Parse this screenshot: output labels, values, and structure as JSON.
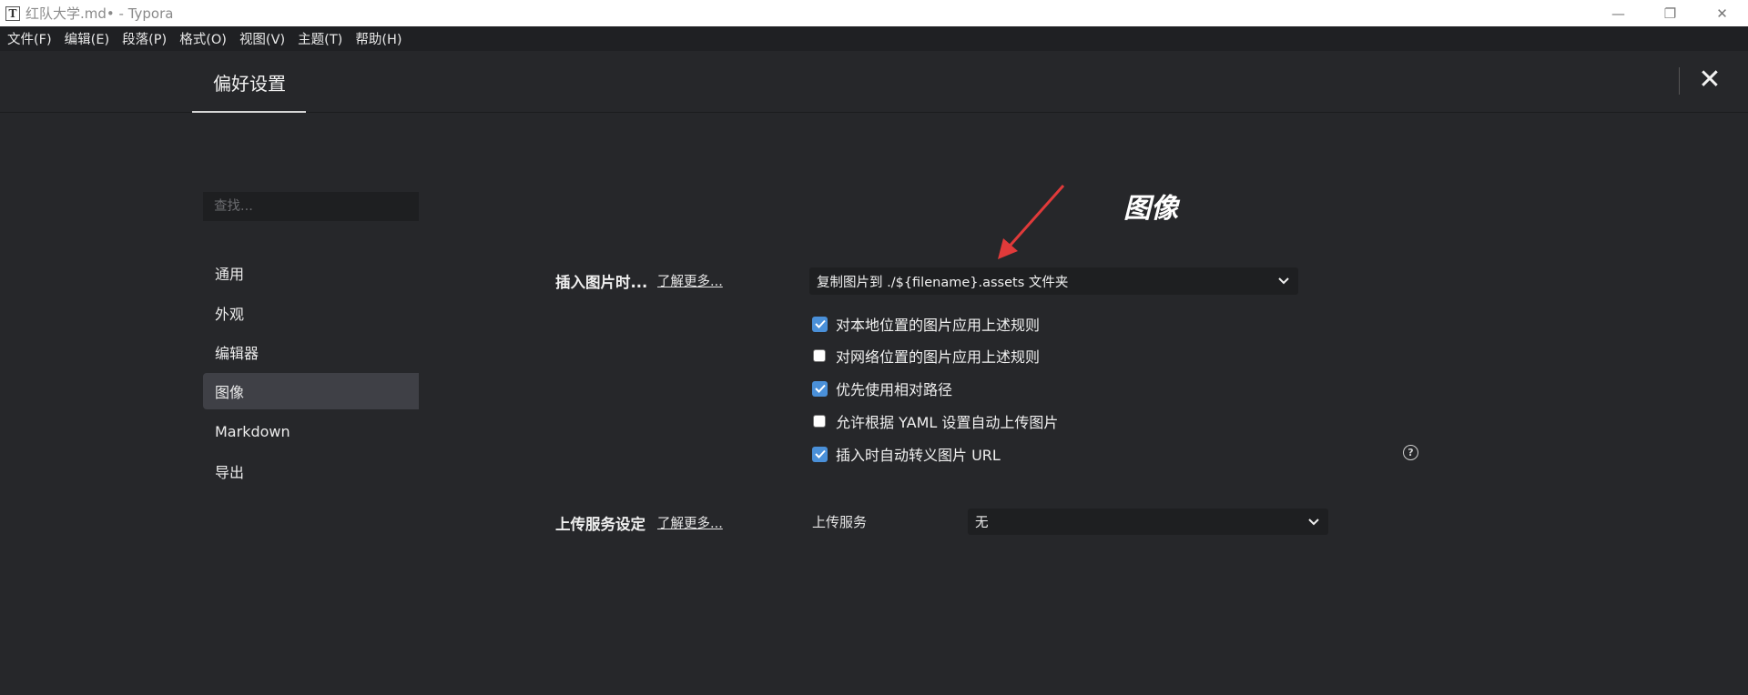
{
  "window": {
    "app_icon_glyph": "T",
    "title": "红队大学.md• - Typora",
    "controls": {
      "minimize": "—",
      "restore": "❐",
      "close": "✕"
    }
  },
  "menubar": {
    "items": [
      "文件(F)",
      "编辑(E)",
      "段落(P)",
      "格式(O)",
      "视图(V)",
      "主题(T)",
      "帮助(H)"
    ]
  },
  "preferences": {
    "title": "偏好设置",
    "close_glyph": "✕",
    "search_placeholder": "查找...",
    "nav": [
      {
        "label": "通用",
        "active": false
      },
      {
        "label": "外观",
        "active": false
      },
      {
        "label": "编辑器",
        "active": false
      },
      {
        "label": "图像",
        "active": true
      },
      {
        "label": "Markdown",
        "active": false
      },
      {
        "label": "导出",
        "active": false
      }
    ]
  },
  "image_section": {
    "heading": "图像",
    "insert": {
      "label": "插入图片时...",
      "learn_more": "了解更多...",
      "selected": "复制图片到 ./${filename}.assets 文件夹"
    },
    "options": [
      {
        "label": "对本地位置的图片应用上述规则",
        "checked": true
      },
      {
        "label": "对网络位置的图片应用上述规则",
        "checked": false
      },
      {
        "label": "优先使用相对路径",
        "checked": true
      },
      {
        "label": "允许根据 YAML 设置自动上传图片",
        "checked": false
      },
      {
        "label": "插入时自动转义图片 URL",
        "checked": true
      }
    ],
    "help_glyph": "?",
    "upload": {
      "label": "上传服务设定",
      "learn_more": "了解更多...",
      "service_label": "上传服务",
      "selected": "无"
    }
  },
  "colors": {
    "background": "#26272a",
    "menubar": "#1f2023",
    "accent": "#4a90d9",
    "annotation_arrow": "#e03a3a"
  }
}
